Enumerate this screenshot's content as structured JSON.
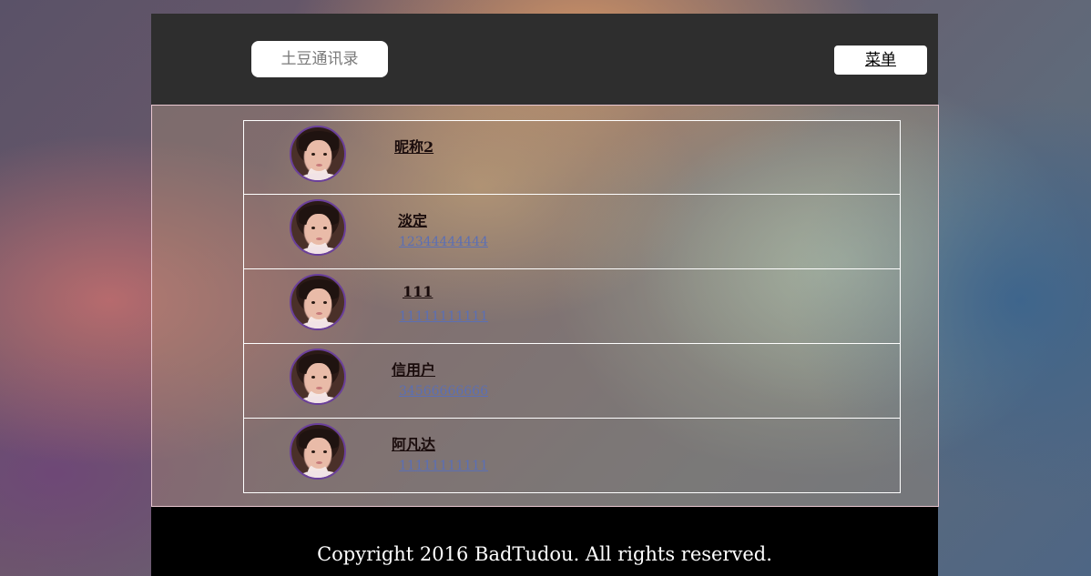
{
  "header": {
    "brand_label": "土豆通讯录",
    "menu_label": "菜单"
  },
  "contacts": [
    {
      "name": "昵称2",
      "phone": ""
    },
    {
      "name": "淡定",
      "phone": "12344444444"
    },
    {
      "name": "111",
      "phone": "11111111111"
    },
    {
      "name": "信用户",
      "phone": "34566666666"
    },
    {
      "name": "阿凡达",
      "phone": "11111111111"
    }
  ],
  "footer": {
    "copyright": "Copyright 2016 BadTudou. All rights reserved."
  },
  "colors": {
    "header_bg": "#2e2e2e",
    "footer_bg": "#000000",
    "phone_link": "#5b6fb4",
    "avatar_ring": "#6a3f9a"
  },
  "icons": {
    "avatar": "user-photo-avatar"
  }
}
